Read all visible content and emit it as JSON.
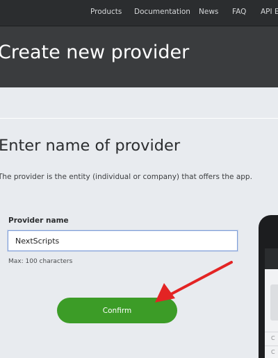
{
  "nav": {
    "items": [
      "Products",
      "Documentation",
      "News",
      "FAQ",
      "API Ex"
    ]
  },
  "header": {
    "title": "Create new provider"
  },
  "form": {
    "section_title": "Enter name of provider",
    "description": "The provider is the entity (individual or company) that offers the app.",
    "label": "Provider name",
    "value": "NextScripts",
    "hint": "Max: 100 characters",
    "confirm_label": "Confirm"
  },
  "phone_preview": {
    "rows": [
      "C",
      "C"
    ]
  },
  "colors": {
    "nav_bg": "#2b2d2f",
    "hero_bg": "#3a3c3e",
    "page_bg": "#e8ebef",
    "button": "#3c9c27",
    "annotation_arrow": "#e32424",
    "input_border": "#7f9fd9"
  }
}
